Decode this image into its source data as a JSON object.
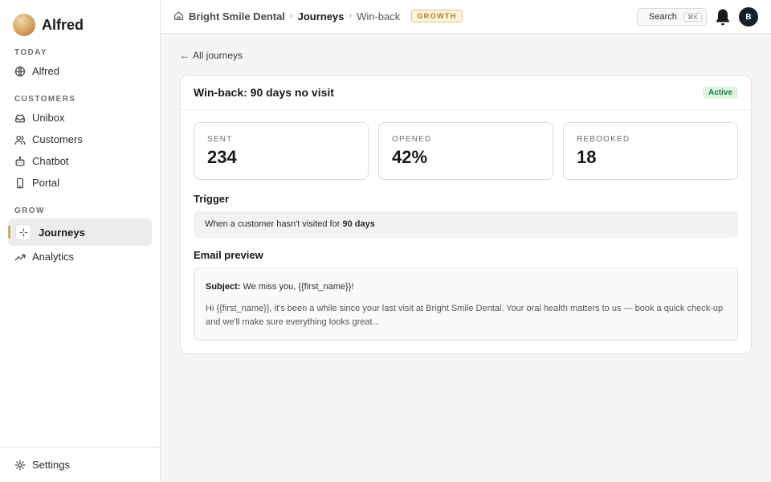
{
  "app": {
    "name": "Alfred",
    "logo_icon": "gradient-circle-logo"
  },
  "sidebar": {
    "sections": {
      "today": "TODAY",
      "customers": "CUSTOMERS",
      "grow": "GROW"
    },
    "items": [
      {
        "label": "Alfred",
        "icon": "globe-icon"
      },
      {
        "label": "Unibox",
        "icon": "inbox-icon"
      },
      {
        "label": "Customers",
        "icon": "users-icon"
      },
      {
        "label": "Chatbot",
        "icon": "bot-icon"
      },
      {
        "label": "Portal",
        "icon": "phone-icon"
      },
      {
        "label": "Journeys",
        "icon": "sparkle-icon",
        "active": true
      },
      {
        "label": "Analytics",
        "icon": "trend-icon"
      }
    ],
    "footer": {
      "label": "Settings",
      "icon": "gear-icon"
    }
  },
  "topbar": {
    "breadcrumb": [
      "Bright Smile Dental",
      "Journeys",
      "Win-back"
    ],
    "plan_badge": "GROWTH",
    "search_label": "Search",
    "search_shortcut": "⌘K",
    "avatar_initial": "B"
  },
  "main": {
    "back_link": "All journeys",
    "journey": {
      "title": "Win-back: 90 days no visit",
      "status": "Active"
    },
    "stats": [
      {
        "label": "SENT",
        "value": "234"
      },
      {
        "label": "OPENED",
        "value": "42%"
      },
      {
        "label": "REBOOKED",
        "value": "18"
      }
    ],
    "trigger": {
      "heading": "Trigger",
      "text": "When a customer hasn't visited for ",
      "emphasis": "90 days"
    },
    "email_preview": {
      "heading": "Email preview",
      "subject_label": "Subject:",
      "subject": " We miss you, {{first_name}}!",
      "body": "Hi {{first_name}}, it's been a while since your last visit at Bright Smile Dental. Your oral health matters to us — book a quick check-up and we'll make sure everything looks great..."
    }
  },
  "colors": {
    "accent": "#d8a667",
    "active_badge_bg": "#def5e3",
    "active_badge_text": "#1f7a3d",
    "growth_badge": "#b07a1e"
  }
}
